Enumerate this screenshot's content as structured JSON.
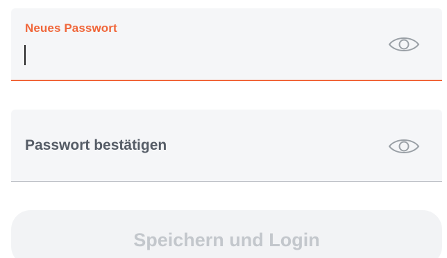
{
  "new_password": {
    "label": "Neues Passwort",
    "value": "",
    "visibility_icon": "eye-icon"
  },
  "confirm_password": {
    "label": "Passwort bestätigen",
    "value": "",
    "visibility_icon": "eye-icon"
  },
  "submit": {
    "label": "Speichern und Login",
    "state": "disabled"
  },
  "colors": {
    "accent": "#f0663a",
    "field_background": "#f5f6f8",
    "label_text": "#555c66",
    "button_background": "#f2f3f5",
    "button_text": "#c3c7cc",
    "icon": "#9aa0a6"
  }
}
